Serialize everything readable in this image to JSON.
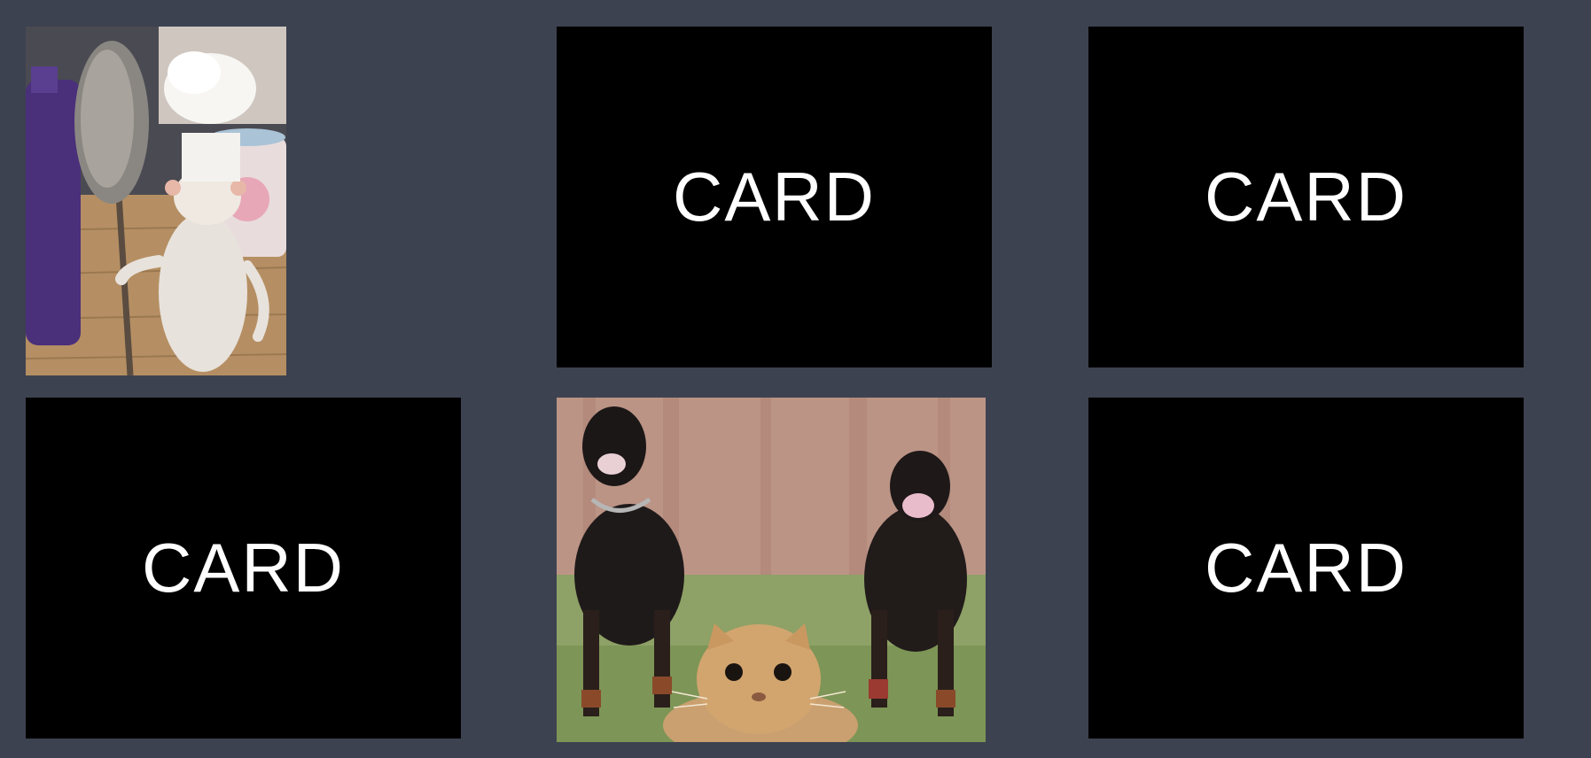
{
  "board": {
    "background_color": "#3d4250",
    "card_back_color": "#000000",
    "cards": [
      {
        "state": "face-up",
        "image": "chef-rat-with-spoon-photo"
      },
      {
        "state": "face-down",
        "label": "CARD"
      },
      {
        "state": "face-down",
        "label": "CARD"
      },
      {
        "state": "face-down",
        "label": "CARD"
      },
      {
        "state": "face-up",
        "image": "rottweilers-chasing-cat-photo"
      },
      {
        "state": "face-down",
        "label": "CARD"
      }
    ]
  }
}
